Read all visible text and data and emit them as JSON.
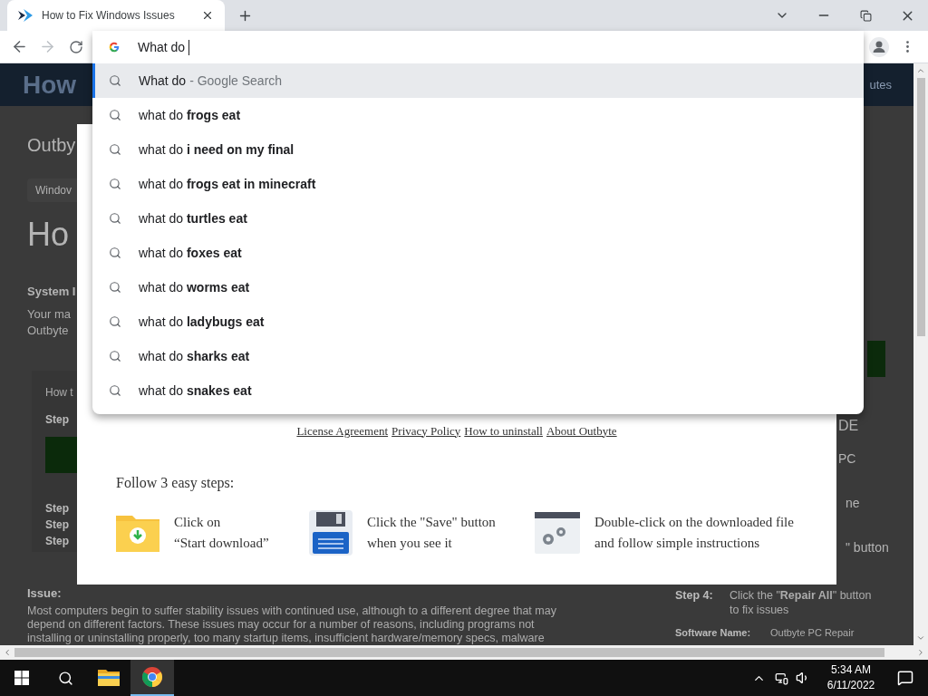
{
  "tab_bar": {
    "tabs": [
      {
        "title": "How to Fix Windows Issues",
        "selected": true
      }
    ]
  },
  "omnibox": {
    "value": "What do"
  },
  "suggestions": [
    {
      "kind": "search",
      "text": "What do",
      "suffix": "- Google Search",
      "selected": true
    },
    {
      "kind": "search",
      "text": "what do **frogs eat**",
      "selected": false
    },
    {
      "kind": "search",
      "text": "what do **i need on my final**",
      "selected": false
    },
    {
      "kind": "search",
      "text": "what do **frogs eat in minecraft**",
      "selected": false
    },
    {
      "kind": "search",
      "text": "what do **turtles eat**",
      "selected": false
    },
    {
      "kind": "search",
      "text": "what do **foxes eat**",
      "selected": false
    },
    {
      "kind": "search",
      "text": "what do **worms eat**",
      "selected": false
    },
    {
      "kind": "search",
      "text": "what do **ladybugs eat**",
      "selected": false
    },
    {
      "kind": "search",
      "text": "what do **sharks eat**",
      "selected": false
    },
    {
      "kind": "search",
      "text": "what do **snakes eat**",
      "selected": false
    }
  ],
  "page": {
    "header": {
      "left": "How",
      "right": "utes"
    },
    "left_column": {
      "site_name": "Outby",
      "breadcrumb": "Windov",
      "heading": "Ho",
      "section_title": "System I",
      "section_text": [
        "Your ma",
        "Outbyte"
      ],
      "steps_box": {
        "title": "How t",
        "steps": [
          "Step",
          "Step",
          "Step",
          "Step"
        ]
      }
    },
    "right_column": [
      "DE",
      "PC",
      "ne",
      "\" button"
    ],
    "dialog": {
      "links": [
        "License Agreement",
        "Privacy Policy",
        "How to uninstall",
        "About Outbyte"
      ],
      "steps_title": "Follow 3 easy steps:",
      "steps": [
        {
          "kind": "download",
          "lines": [
            "Click on",
            "“Start download”"
          ]
        },
        {
          "kind": "save",
          "lines": [
            "Click the \"Save\" button",
            "when you see it"
          ]
        },
        {
          "kind": "install",
          "lines": [
            "Double-click on the downloaded file",
            "and follow simple instructions"
          ]
        }
      ]
    },
    "issue": {
      "title": "Issue:",
      "lines": [
        "Most computers begin to suffer stability issues with continued use, although to a different degree that may",
        "depend on different factors. These issues may occur for a number of reasons, including programs not",
        "installing or uninstalling properly, too many startup items, insufficient hardware/memory specs, malware"
      ]
    },
    "step_4": {
      "label": "Step 4:",
      "lines": [
        "Click the \"**Repair All**\" button",
        "to fix issues"
      ]
    },
    "software": {
      "label": "Software Name:",
      "value": "Outbyte PC Repair"
    }
  },
  "taskbar": {
    "apps": [
      {
        "kind": "explorer",
        "selected": false
      },
      {
        "kind": "chrome",
        "selected": true
      }
    ],
    "time": "5:34 AM",
    "date": "6/11/2022"
  }
}
